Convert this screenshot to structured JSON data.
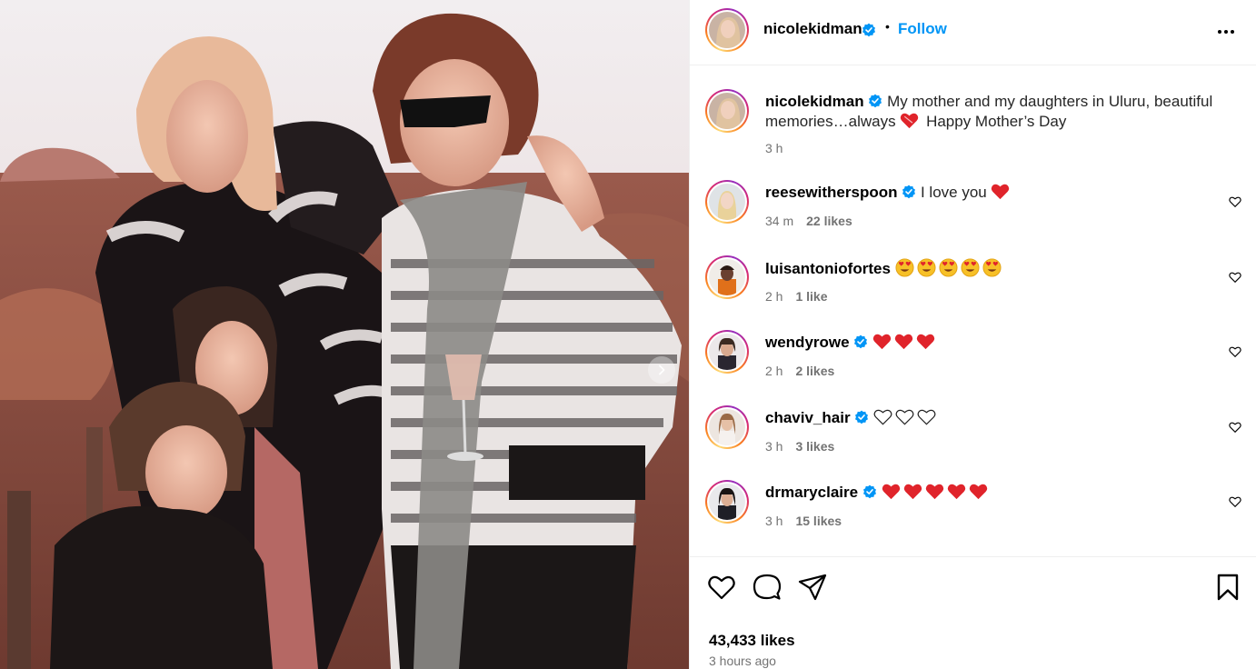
{
  "post": {
    "author": "nicolekidman",
    "follow_label": "Follow",
    "separator": "•",
    "caption_line1": "My mother and my daughters in Uluru, beautiful",
    "caption_line2": "memories…always",
    "caption_line2_end": "Happy Mother’s Day",
    "caption_time": "3 h",
    "likes": "43,433 likes",
    "posted_ago": "3 hours ago"
  },
  "comments": [
    {
      "user": "reesewitherspoon",
      "verified": true,
      "text": "I love you",
      "time": "34 m",
      "likes": "22 likes"
    },
    {
      "user": "luisantoniofortes",
      "verified": false,
      "text": "",
      "time": "2 h",
      "likes": "1 like"
    },
    {
      "user": "wendyrowe",
      "verified": true,
      "text": "",
      "time": "2 h",
      "likes": "2 likes"
    },
    {
      "user": "chaviv_hair",
      "verified": true,
      "text": "",
      "time": "3 h",
      "likes": "3 likes"
    },
    {
      "user": "drmaryclaire",
      "verified": true,
      "text": "",
      "time": "3 h",
      "likes": "15 likes"
    }
  ],
  "icons": {
    "more": "more-options-icon",
    "verified": "verified-badge-icon",
    "like": "heart-icon",
    "comment": "comment-icon",
    "share": "share-icon",
    "save": "bookmark-icon",
    "carousel_next": "chevron-right-icon"
  },
  "colors": {
    "accent": "#0095f6",
    "verified": "#0095f6",
    "muted_text": "#737373",
    "heart_emoji": "#e0242b"
  }
}
